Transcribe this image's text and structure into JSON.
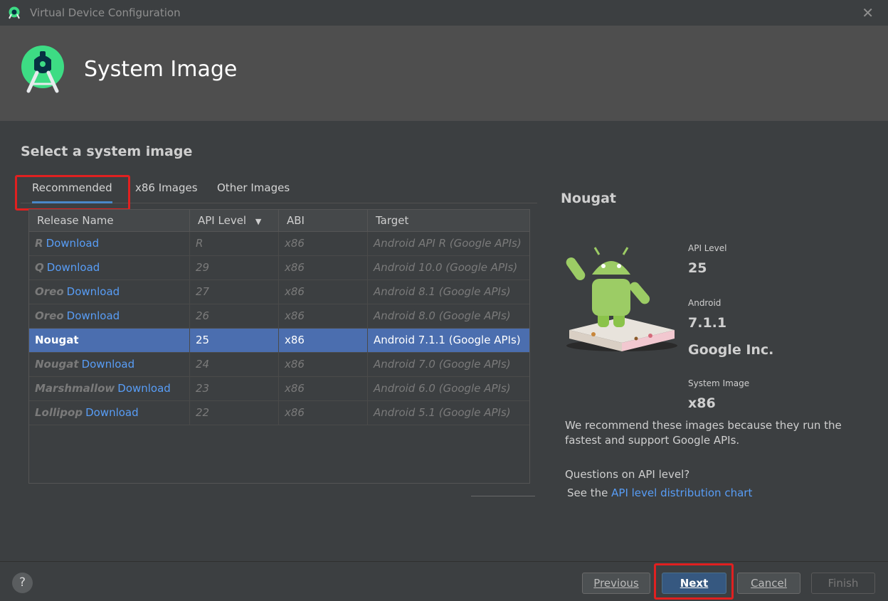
{
  "window": {
    "title": "Virtual Device Configuration",
    "close_glyph": "✕"
  },
  "header": {
    "title": "System Image"
  },
  "section_title": "Select a system image",
  "tabs": [
    {
      "label": "Recommended",
      "active": true
    },
    {
      "label": "x86 Images",
      "active": false
    },
    {
      "label": "Other Images",
      "active": false
    }
  ],
  "table": {
    "columns": [
      "Release Name",
      "API Level",
      "ABI",
      "Target"
    ],
    "sort_indicator": "▼",
    "rows": [
      {
        "release": "R",
        "download": "Download",
        "api": "R",
        "abi": "x86",
        "target": "Android API R (Google APIs)"
      },
      {
        "release": "Q",
        "download": "Download",
        "api": "29",
        "abi": "x86",
        "target": "Android 10.0 (Google APIs)"
      },
      {
        "release": "Oreo",
        "download": "Download",
        "api": "27",
        "abi": "x86",
        "target": "Android 8.1 (Google APIs)"
      },
      {
        "release": "Oreo",
        "download": "Download",
        "api": "26",
        "abi": "x86",
        "target": "Android 8.0 (Google APIs)"
      },
      {
        "release": "Nougat",
        "download": "",
        "api": "25",
        "abi": "x86",
        "target": "Android 7.1.1 (Google APIs)",
        "selected": true
      },
      {
        "release": "Nougat",
        "download": "Download",
        "api": "24",
        "abi": "x86",
        "target": "Android 7.0 (Google APIs)"
      },
      {
        "release": "Marshmallow",
        "download": "Download",
        "api": "23",
        "abi": "x86",
        "target": "Android 6.0 (Google APIs)"
      },
      {
        "release": "Lollipop",
        "download": "Download",
        "api": "22",
        "abi": "x86",
        "target": "Android 5.1 (Google APIs)"
      }
    ]
  },
  "details": {
    "title": "Nougat",
    "api_level_label": "API Level",
    "api_level_value": "25",
    "android_label": "Android",
    "android_value": "7.1.1",
    "vendor": "Google Inc.",
    "system_image_label": "System Image",
    "system_image_value": "x86",
    "description": "We recommend these images because they run the fastest and support Google APIs.",
    "question": "Questions on API level?",
    "see_prefix": "See the ",
    "see_link": "API level distribution chart"
  },
  "footer": {
    "help": "?",
    "previous": "Previous",
    "next": "Next",
    "cancel": "Cancel",
    "finish": "Finish"
  },
  "colors": {
    "accent": "#4a88c7",
    "selection": "#4b6eaf",
    "link": "#589df6",
    "highlight": "#e02020"
  }
}
